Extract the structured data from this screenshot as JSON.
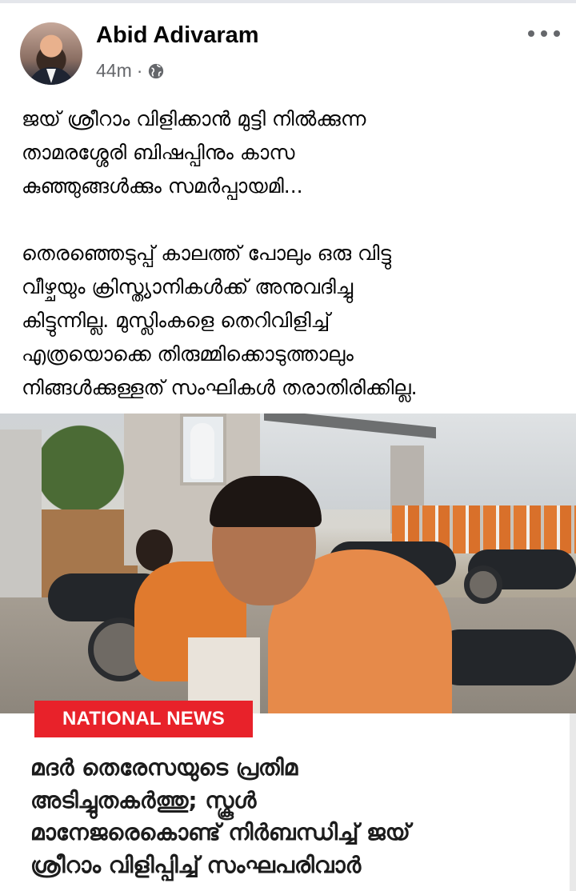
{
  "post": {
    "author": "Abid Adivaram",
    "time": "44m",
    "separator": "·",
    "privacy_icon": "globe-icon",
    "more_icon": "more-options-icon",
    "text_lines": [
      "ജയ് ശ്രീറാം വിളിക്കാൻ മുട്ടി നിൽക്കുന്ന",
      "താമരശ്ശേരി ബിഷപ്പിനും കാസ",
      "കുഞ്ഞുങ്ങൾക്കും സമർപ്പായമി...",
      "",
      "തെരഞ്ഞെടുപ്പ് കാലത്ത് പോലും ഒരു വിട്ടു",
      "വീഴ്ചയും ക്രിസ്ത്യാനികൾക്ക് അനുവദിച്ചു",
      "കിട്ടുന്നില്ല. മുസ്ലിംകളെ തെറിവിളിച്ച്",
      "എത്രയൊക്കെ തിരുമ്മിക്കൊടുത്താലും",
      "നിങ്ങൾക്കുള്ളത് സംഘികൾ തരാതിരിക്കില്ല."
    ]
  },
  "news_card": {
    "tag": "NATIONAL NEWS",
    "tag_color": "#e8222a",
    "headline_lines": [
      "മദർ തെരേസയുടെ പ്രതിമ",
      "അടിച്ചുതകർത്തു; സ്കൂൾ",
      "മാനേജരെകൊണ്ട് നിർബന്ധിച്ച് ജയ്",
      "ശ്രീറാം വിളിപ്പിച്ച് സംഘപരിവാർ"
    ]
  }
}
